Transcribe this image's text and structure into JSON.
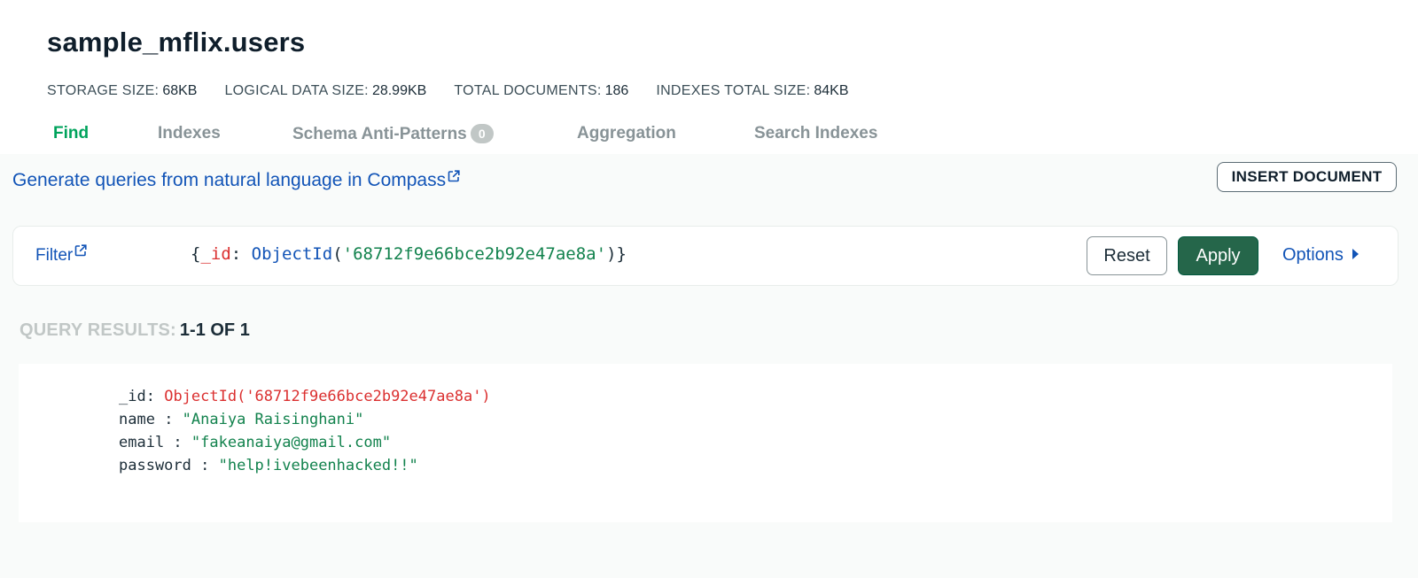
{
  "collection": {
    "title": "sample_mflix.users",
    "stats": [
      {
        "label": "STORAGE SIZE:",
        "value": "68KB"
      },
      {
        "label": "LOGICAL DATA SIZE:",
        "value": "28.99KB"
      },
      {
        "label": "TOTAL DOCUMENTS:",
        "value": "186"
      },
      {
        "label": "INDEXES TOTAL SIZE:",
        "value": "84KB"
      }
    ]
  },
  "tabs": [
    {
      "label": "Find",
      "active": true
    },
    {
      "label": "Indexes",
      "active": false
    },
    {
      "label": "Schema Anti-Patterns",
      "badge": "0",
      "active": false
    },
    {
      "label": "Aggregation",
      "active": false
    },
    {
      "label": "Search Indexes",
      "active": false
    }
  ],
  "toolbar": {
    "nl_link": "Generate queries from natural language in Compass",
    "insert_label": "INSERT DOCUMENT"
  },
  "filter": {
    "label": "Filter",
    "query": {
      "open": "{",
      "key": "_id",
      "colon": ": ",
      "fn": "ObjectId",
      "paren_open": "(",
      "arg": "'68712f9e66bce2b92e47ae8a'",
      "paren_close": ")",
      "close": "}"
    },
    "reset_label": "Reset",
    "apply_label": "Apply",
    "options_label": "Options"
  },
  "results": {
    "label": "QUERY RESULTS:",
    "range": "1-1 OF 1",
    "documents": [
      {
        "fields": [
          {
            "key": "_id",
            "sep": ": ",
            "value": "ObjectId('68712f9e66bce2b92e47ae8a')",
            "type": "oid"
          },
          {
            "key": "name",
            "sep": " : ",
            "value": "\"Anaiya Raisinghani\"",
            "type": "string"
          },
          {
            "key": "email",
            "sep": " : ",
            "value": "\"fakeanaiya@gmail.com\"",
            "type": "string"
          },
          {
            "key": "password",
            "sep": " : ",
            "value": "\"help!ivebeenhacked!!\"",
            "type": "string"
          }
        ]
      }
    ]
  },
  "colors": {
    "accent_green": "#00a35c",
    "apply_bg": "#25664a",
    "link_blue": "#1254b7",
    "key_red": "#db3030",
    "string_green": "#12824d"
  }
}
